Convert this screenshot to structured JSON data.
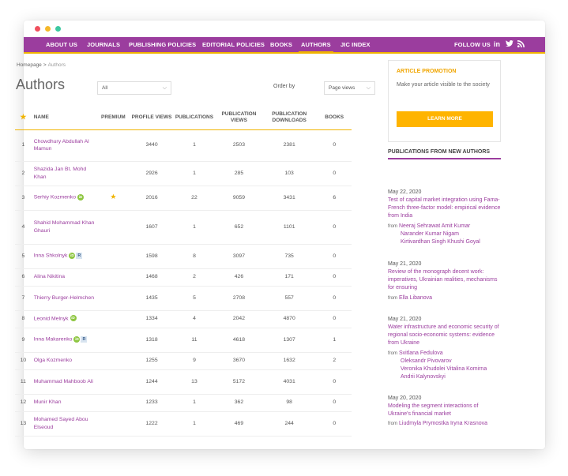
{
  "nav": {
    "items": [
      "ABOUT US",
      "JOURNALS",
      "PUBLISHING POLICIES",
      "EDITORIAL POLICIES",
      "BOOKS",
      "AUTHORS",
      "JIC INDEX"
    ],
    "follow_label": "FOLLOW US",
    "social_icons": [
      "linkedin-icon",
      "twitter-icon",
      "rss-icon"
    ],
    "accent_color": "#9b3d9e",
    "highlight_color": "#f0b400"
  },
  "breadcrumb": {
    "home": "Homepage",
    "sep": ">",
    "current": "Authors"
  },
  "page": {
    "title": "Authors"
  },
  "filter": {
    "selected": "All"
  },
  "order": {
    "label": "Order by",
    "selected": "Page views"
  },
  "table": {
    "headers": {
      "name": "NAME",
      "premium": "PREMIUM",
      "profile_views": "PROFILE VIEWS",
      "publications": "PUBLICATIONS",
      "publication_views": "PUBLICATION VIEWS",
      "publication_downloads": "PUBLICATION DOWNLOADS",
      "books": "BOOKS"
    },
    "rows": [
      {
        "n": "1",
        "name": "Chowdhury Abdullah Al Mamun",
        "premium": false,
        "badges": [],
        "profile_views": "3440",
        "publications": "1",
        "pub_views": "2503",
        "pub_downloads": "2381",
        "books": "0"
      },
      {
        "n": "2",
        "name": "Shazida Jan Bt. Mohd Khan",
        "premium": false,
        "badges": [],
        "profile_views": "2926",
        "publications": "1",
        "pub_views": "285",
        "pub_downloads": "103",
        "books": "0"
      },
      {
        "n": "3",
        "name": "Serhiy Kozmenko",
        "premium": true,
        "badges": [
          "orcid"
        ],
        "profile_views": "2016",
        "publications": "22",
        "pub_views": "9059",
        "pub_downloads": "3431",
        "books": "6"
      },
      {
        "n": "4",
        "name": "Shahid Mohammad Khan Ghauri",
        "premium": false,
        "badges": [],
        "profile_views": "1607",
        "publications": "1",
        "pub_views": "652",
        "pub_downloads": "1101",
        "books": "0"
      },
      {
        "n": "5",
        "name": "Inna Shkolnyk",
        "premium": false,
        "badges": [
          "orcid",
          "researcherid"
        ],
        "profile_views": "1598",
        "publications": "8",
        "pub_views": "3097",
        "pub_downloads": "735",
        "books": "0"
      },
      {
        "n": "6",
        "name": "Alina Nikitina",
        "premium": false,
        "badges": [],
        "profile_views": "1468",
        "publications": "2",
        "pub_views": "426",
        "pub_downloads": "171",
        "books": "0"
      },
      {
        "n": "7",
        "name": "Thierry Burger-Helmchen",
        "premium": false,
        "badges": [],
        "profile_views": "1435",
        "publications": "5",
        "pub_views": "2708",
        "pub_downloads": "557",
        "books": "0"
      },
      {
        "n": "8",
        "name": "Leonid Melnyk",
        "premium": false,
        "badges": [
          "orcid"
        ],
        "profile_views": "1334",
        "publications": "4",
        "pub_views": "2042",
        "pub_downloads": "4870",
        "books": "0"
      },
      {
        "n": "9",
        "name": "Inna Makarenko",
        "premium": false,
        "badges": [
          "orcid",
          "researcherid"
        ],
        "profile_views": "1318",
        "publications": "11",
        "pub_views": "4618",
        "pub_downloads": "1307",
        "books": "1"
      },
      {
        "n": "10",
        "name": "Olga Kozmenko",
        "premium": false,
        "badges": [],
        "profile_views": "1255",
        "publications": "9",
        "pub_views": "3670",
        "pub_downloads": "1632",
        "books": "2"
      },
      {
        "n": "11",
        "name": "Muhammad Mahboob Ali",
        "premium": false,
        "badges": [],
        "profile_views": "1244",
        "publications": "13",
        "pub_views": "5172",
        "pub_downloads": "4031",
        "books": "0"
      },
      {
        "n": "12",
        "name": "Munir Khan",
        "premium": false,
        "badges": [],
        "profile_views": "1233",
        "publications": "1",
        "pub_views": "362",
        "pub_downloads": "98",
        "books": "0"
      },
      {
        "n": "13",
        "name": "Mohamed Sayed Abou Elseoud",
        "premium": false,
        "badges": [],
        "profile_views": "1222",
        "publications": "1",
        "pub_views": "469",
        "pub_downloads": "244",
        "books": "0"
      }
    ]
  },
  "promo": {
    "title": "ARTICLE PROMOTION",
    "text": "Make your article visible to the society",
    "button": "LEARN MORE"
  },
  "new_pubs": {
    "title": "PUBLICATIONS FROM NEW AUTHORS",
    "from_label": "from",
    "items": [
      {
        "date": "May 22, 2020",
        "title": "Test of capital market integration using Fama-French three-factor model: empirical evidence from India",
        "authors": [
          "Neeraj Sehrawat Amit Kumar",
          "Narander Kumar Nigam",
          "Kirtivardhan Singh Khushi Goyal"
        ]
      },
      {
        "date": "May 21, 2020",
        "title": "Review of the monograph decent work: imperatives, Ukrainian realities, mechanisms for ensuring",
        "authors": [
          "Ella Libanova"
        ]
      },
      {
        "date": "May 21, 2020",
        "title": "Water infrastructure and economic security of regional socio-economic systems: evidence from Ukraine",
        "authors": [
          "Svitlana Fedulova",
          "Oleksandr Pivovarov",
          "Veronika Khudolei Vitalina Komirna",
          "Andrii Kalynovskyi"
        ]
      },
      {
        "date": "May 20, 2020",
        "title": "Modeling the segment interactions of Ukraine's financial market",
        "authors": [
          "Liudmyla Prymostka Iryna Krasnova"
        ]
      }
    ]
  }
}
